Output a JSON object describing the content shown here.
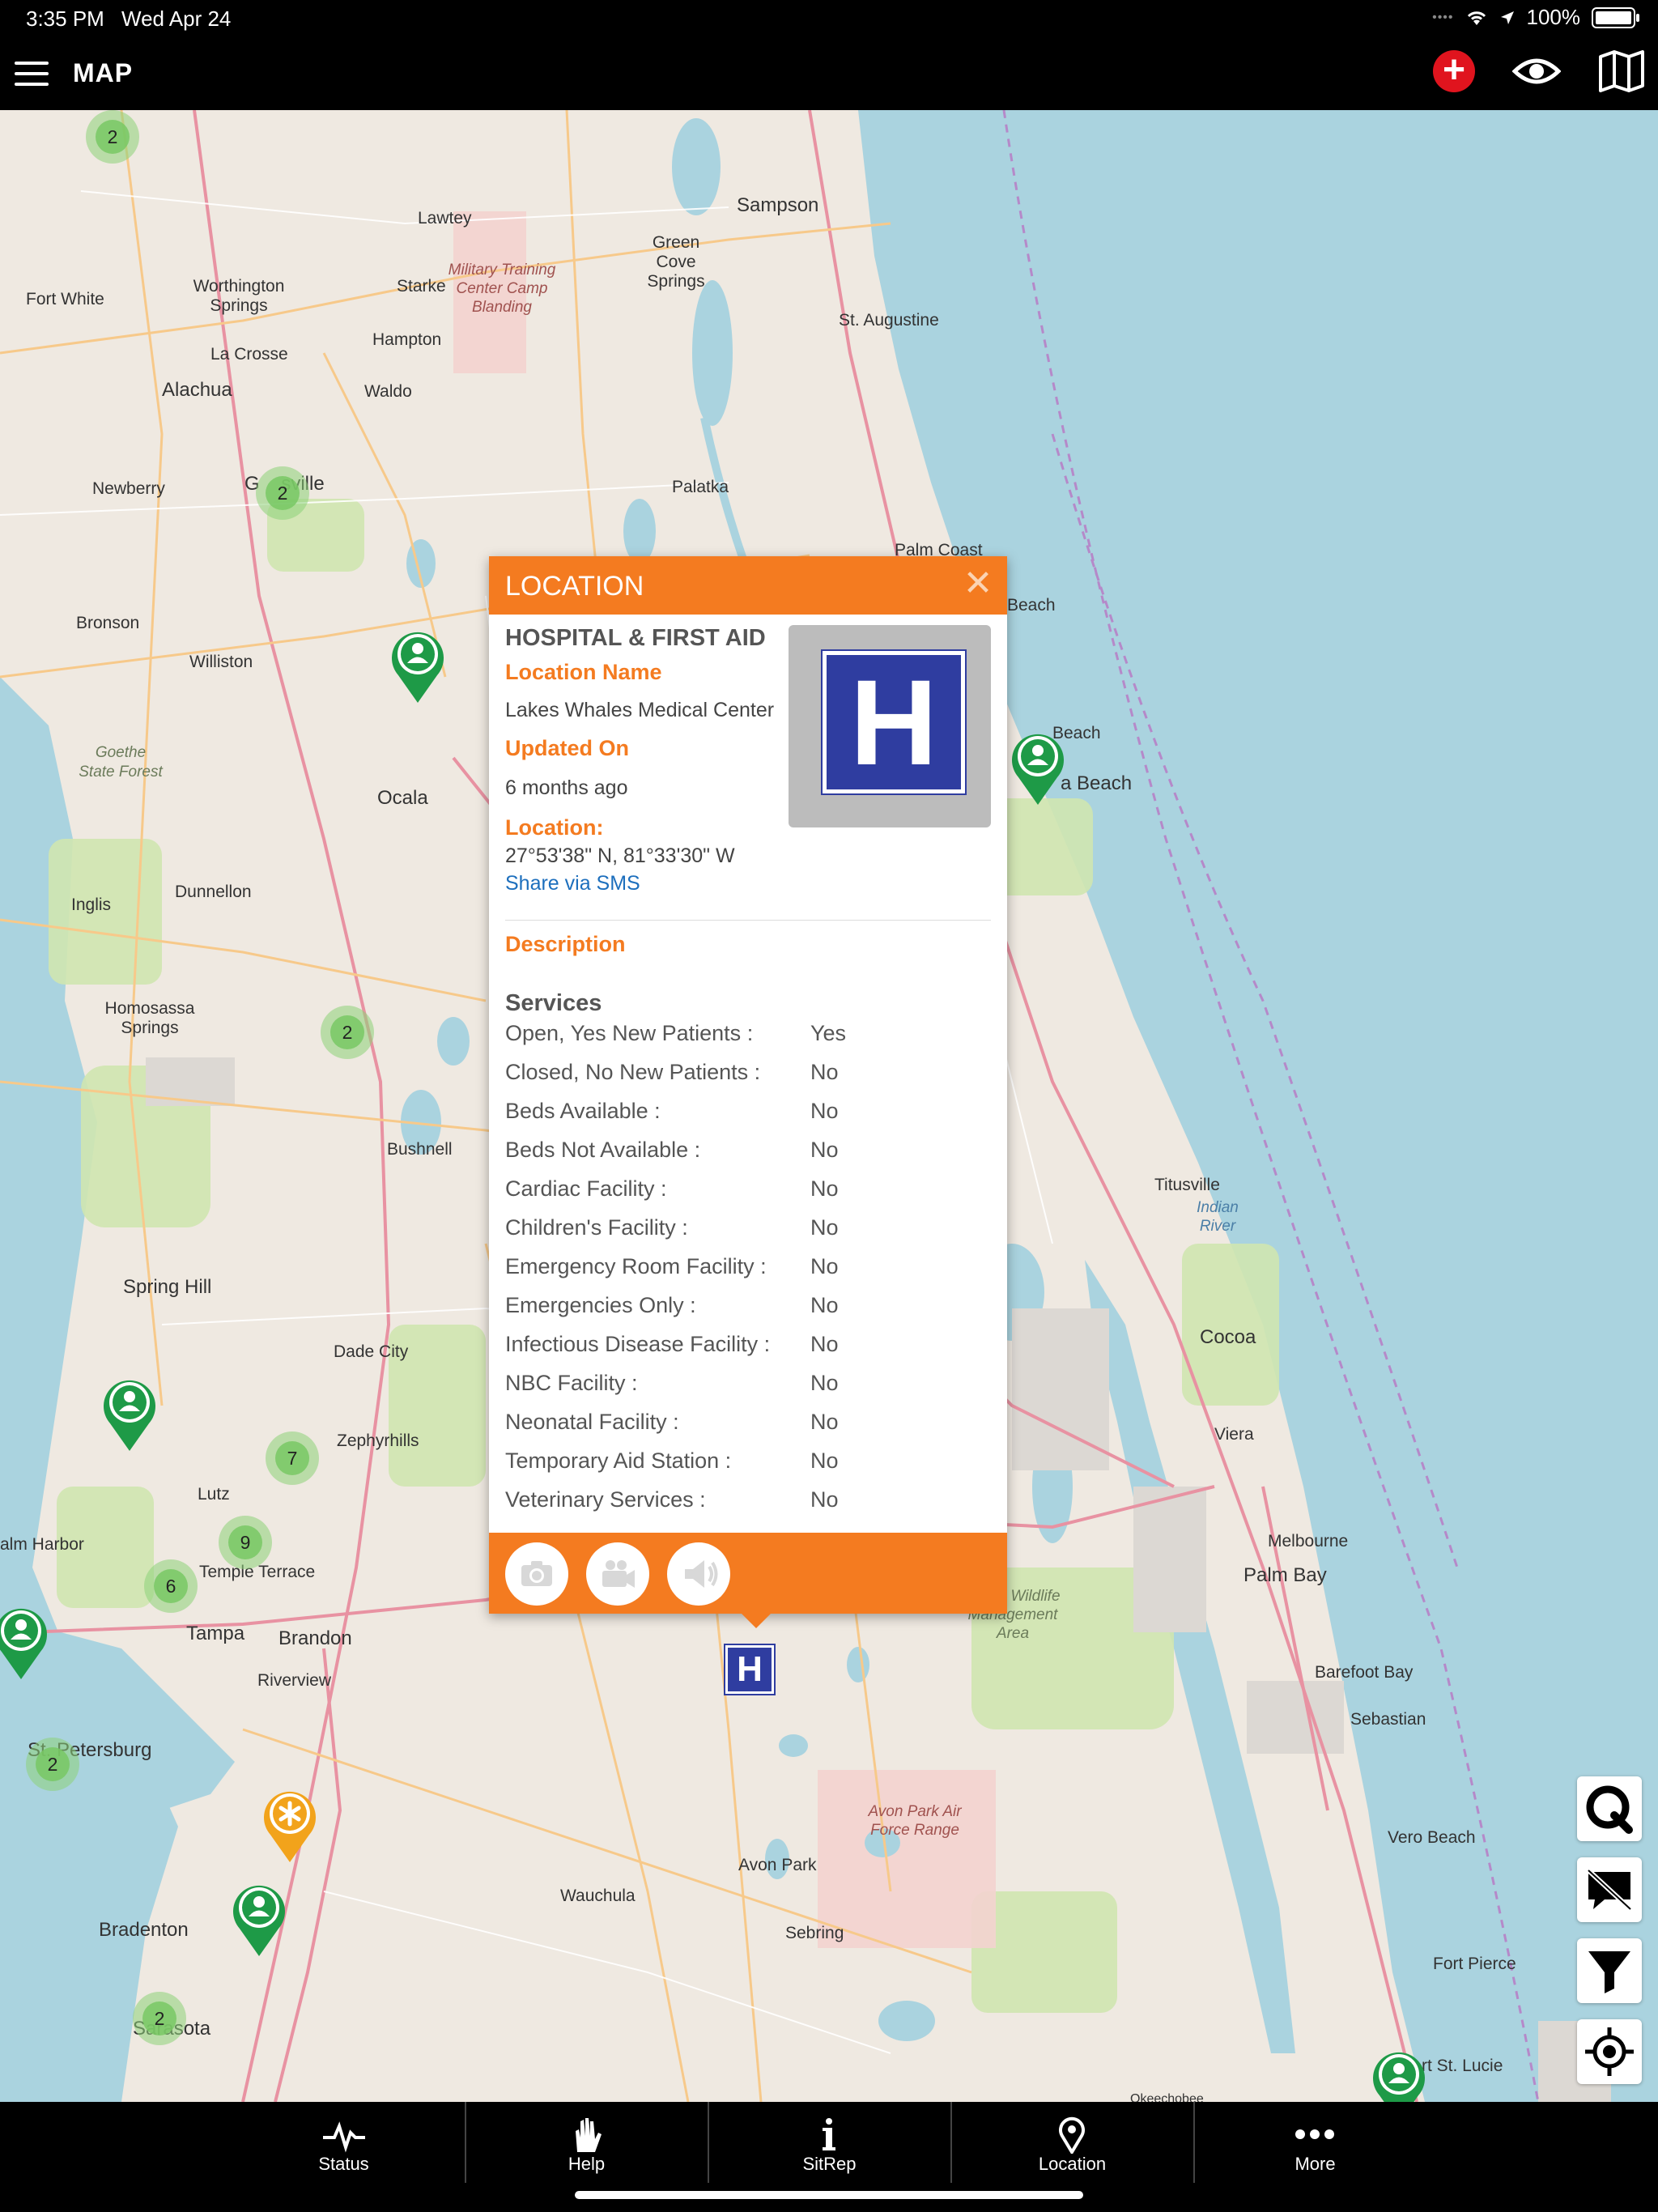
{
  "status_bar": {
    "time": "3:35 PM",
    "date": "Wed Apr 24",
    "battery": "100%"
  },
  "nav": {
    "title": "MAP",
    "icons": [
      "menu-icon",
      "add-emergency-icon",
      "eye-icon",
      "map-layers-icon"
    ]
  },
  "map": {
    "places": [
      {
        "id": "lawtey",
        "label": "Lawtey"
      },
      {
        "id": "sampson",
        "label": "Sampson"
      },
      {
        "id": "greencove",
        "label": "Green Cove Springs"
      },
      {
        "id": "fortwhite",
        "label": "Fort White"
      },
      {
        "id": "worthington",
        "label": "Worthington Springs"
      },
      {
        "id": "starke",
        "label": "Starke"
      },
      {
        "id": "military",
        "label": "Military Training Center Camp Blanding"
      },
      {
        "id": "staugustine",
        "label": "St. Augustine"
      },
      {
        "id": "lacrosse",
        "label": "La Crosse"
      },
      {
        "id": "hampton",
        "label": "Hampton"
      },
      {
        "id": "alachua",
        "label": "Alachua"
      },
      {
        "id": "waldo",
        "label": "Waldo"
      },
      {
        "id": "newberry",
        "label": "Newberry"
      },
      {
        "id": "gainesville",
        "label": "G    sville"
      },
      {
        "id": "palatka",
        "label": "Palatka"
      },
      {
        "id": "palmcoast",
        "label": "Palm Coast"
      },
      {
        "id": "bronson",
        "label": "Bronson"
      },
      {
        "id": "williston",
        "label": "Williston"
      },
      {
        "id": "goethe",
        "label": "Goethe State Forest"
      },
      {
        "id": "ocala",
        "label": "Ocala"
      },
      {
        "id": "inglis",
        "label": "Inglis"
      },
      {
        "id": "dunnellon",
        "label": "Dunnellon"
      },
      {
        "id": "homosassa",
        "label": "Homosassa Springs"
      },
      {
        "id": "bushnell",
        "label": "Bushnell"
      },
      {
        "id": "springhill",
        "label": "Spring Hill"
      },
      {
        "id": "dadecity",
        "label": "Dade City"
      },
      {
        "id": "zephyrhills",
        "label": "Zephyrhills"
      },
      {
        "id": "lutz",
        "label": "Lutz"
      },
      {
        "id": "palmharbor",
        "label": "alm Harbor"
      },
      {
        "id": "templeterrace",
        "label": "Temple Terrace"
      },
      {
        "id": "tampa",
        "label": "Tampa"
      },
      {
        "id": "brandon",
        "label": "Brandon"
      },
      {
        "id": "riverview",
        "label": "Riverview"
      },
      {
        "id": "stpete",
        "label": "St. Petersburg"
      },
      {
        "id": "bradenton",
        "label": "Bradenton"
      },
      {
        "id": "sarasota",
        "label": "Sarasota"
      },
      {
        "id": "wauchula",
        "label": "Wauchula"
      },
      {
        "id": "avonpark",
        "label": "Avon Park"
      },
      {
        "id": "avonparkrange",
        "label": "Avon Park Air Force Range"
      },
      {
        "id": "sebring",
        "label": "Sebring"
      },
      {
        "id": "lakeswales",
        "label": "Lakes Wildlife Management Area"
      },
      {
        "id": "titusville",
        "label": "Titusville"
      },
      {
        "id": "indianriver",
        "label": "Indian River"
      },
      {
        "id": "cocoa",
        "label": "Cocoa"
      },
      {
        "id": "viera",
        "label": "Viera"
      },
      {
        "id": "melbourne",
        "label": "Melbourne"
      },
      {
        "id": "palmbay",
        "label": "Palm Bay"
      },
      {
        "id": "barefoot",
        "label": "Barefoot Bay"
      },
      {
        "id": "sebastian",
        "label": "Sebastian"
      },
      {
        "id": "verobeach",
        "label": "Vero Beach"
      },
      {
        "id": "fortpierce",
        "label": "Fort Pierce"
      },
      {
        "id": "stlucie",
        "label": "rt St. Lucie"
      },
      {
        "id": "daytona",
        "label": "a Beach"
      },
      {
        "id": "beach1",
        "label": "Beach"
      },
      {
        "id": "beach2",
        "label": "Beach"
      },
      {
        "id": "okeechobee",
        "label": "Okeechobee"
      }
    ],
    "clusters": [
      {
        "id": "c1",
        "count": "2"
      },
      {
        "id": "c2",
        "count": "2"
      },
      {
        "id": "c3",
        "count": "2"
      },
      {
        "id": "c4",
        "count": "7"
      },
      {
        "id": "c5",
        "count": "9"
      },
      {
        "id": "c6",
        "count": "6"
      },
      {
        "id": "c7",
        "count": "2"
      },
      {
        "id": "c8",
        "count": "2"
      }
    ],
    "hospital_marker": "H"
  },
  "popup": {
    "header": "LOCATION",
    "close_icon": "close-icon",
    "category": "HOSPITAL & FIRST AID",
    "location_name_label": "Location Name",
    "location_name": "Lakes Whales Medical Center",
    "updated_label": "Updated On",
    "updated_value": "6 months ago",
    "location_label": "Location:",
    "coordinates": "27°53'38\" N, 81°33'30\" W",
    "share_link": "Share via SMS",
    "image_letter": "H",
    "description_label": "Description",
    "services_title": "Services",
    "services": [
      {
        "k": "Open, Yes New Patients :",
        "v": "Yes"
      },
      {
        "k": "Closed, No New Patients :",
        "v": "No"
      },
      {
        "k": "Beds Available :",
        "v": "No"
      },
      {
        "k": "Beds Not Available :",
        "v": "No"
      },
      {
        "k": "Cardiac Facility :",
        "v": "No"
      },
      {
        "k": "Children's Facility :",
        "v": "No"
      },
      {
        "k": "Emergency Room Facility :",
        "v": "No"
      },
      {
        "k": "Emergencies Only :",
        "v": "No"
      },
      {
        "k": "Infectious Disease Facility :",
        "v": "No"
      },
      {
        "k": "NBC Facility :",
        "v": "No"
      },
      {
        "k": "Neonatal Facility :",
        "v": "No"
      },
      {
        "k": "Temporary Aid Station :",
        "v": "No"
      },
      {
        "k": "Veterinary Services :",
        "v": "No"
      }
    ],
    "footer_icons": [
      "camera-icon",
      "video-icon",
      "megaphone-icon"
    ]
  },
  "map_buttons": [
    "search-q-icon",
    "hide-messages-icon",
    "filter-icon",
    "locate-icon"
  ],
  "tabs": [
    {
      "label": "Status",
      "icon": "pulse-icon"
    },
    {
      "label": "Help",
      "icon": "hand-icon"
    },
    {
      "label": "SitRep",
      "icon": "info-icon"
    },
    {
      "label": "Location",
      "icon": "location-pin-icon"
    },
    {
      "label": "More",
      "icon": "more-dots-icon"
    }
  ],
  "colors": {
    "accent": "#f47b20",
    "pin_green": "#1e9a47",
    "pin_orange": "#f2a31b",
    "hospital_blue": "#2f3da0",
    "water": "#aad3df"
  }
}
